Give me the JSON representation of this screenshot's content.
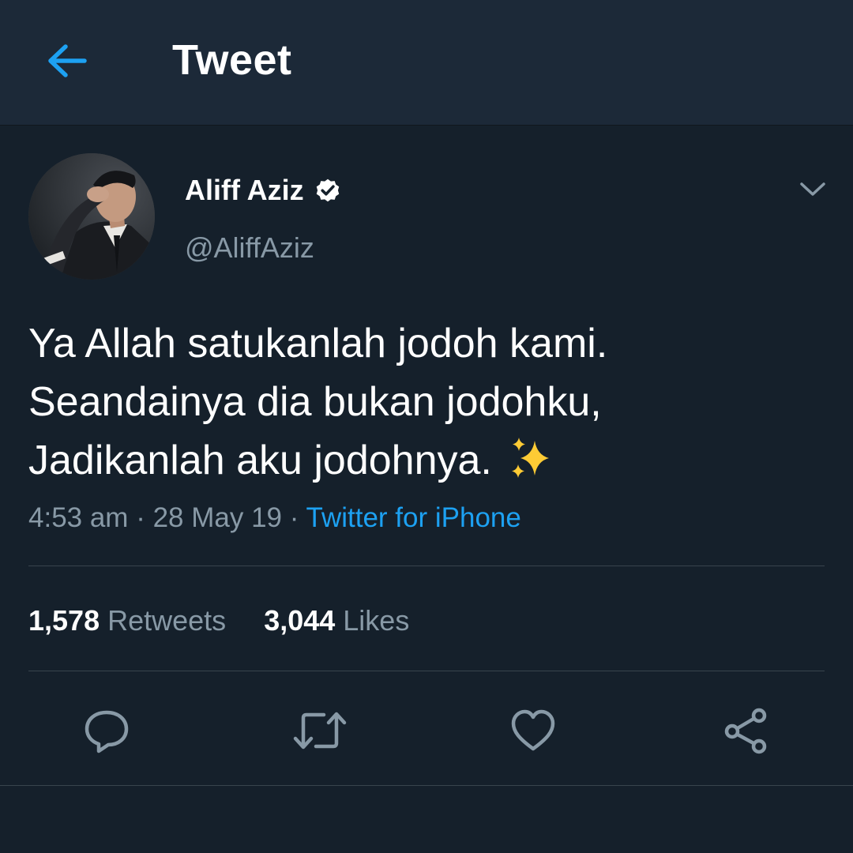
{
  "header": {
    "title": "Tweet",
    "back_icon": "arrow-left-icon"
  },
  "colors": {
    "background": "#15202b",
    "header_background": "#1c2938",
    "accent": "#1da1f2",
    "secondary_text": "#8899a6",
    "divider": "#38444d"
  },
  "tweet": {
    "author": {
      "display_name": "Aliff Aziz",
      "handle": "@AliffAziz",
      "verified": true
    },
    "text_lines": [
      "Ya Allah satukanlah jodoh kami.",
      "Seandainya dia bukan jodohku,",
      "Jadikanlah aku jodohnya."
    ],
    "emoji": "✨",
    "time": "4:53 am",
    "date": "28 May 19",
    "separator": "·",
    "source": "Twitter for iPhone",
    "stats": {
      "retweets_count": "1,578",
      "retweets_label": "Retweets",
      "likes_count": "3,044",
      "likes_label": "Likes"
    }
  },
  "actions": [
    {
      "icon": "reply-icon"
    },
    {
      "icon": "retweet-icon"
    },
    {
      "icon": "like-icon"
    },
    {
      "icon": "share-icon"
    }
  ]
}
